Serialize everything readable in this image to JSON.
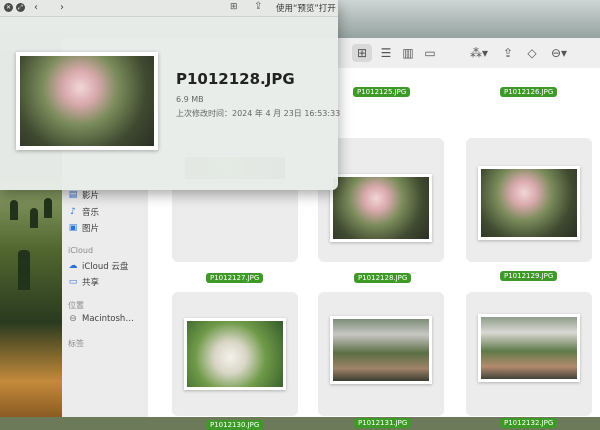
{
  "window": {
    "open_with": "使用“预览”打开"
  },
  "preview": {
    "file_name": "P1012128.JPG",
    "file_size": "6.9 MB",
    "modified": "上次修改时间：2024 年 4 月 23日 16:53:33"
  },
  "sidebar": {
    "items_top": [
      {
        "icon": "music-icon",
        "label": "音乐"
      },
      {
        "icon": "photo-icon",
        "label": "图片"
      }
    ],
    "icloud_header": "iCloud",
    "icloud_items": [
      {
        "icon": "cloud-icon",
        "label": "iCloud 云盘"
      },
      {
        "icon": "shared-folder-icon",
        "label": "共享"
      }
    ],
    "locations_header": "位置",
    "location_items": [
      {
        "icon": "disk-icon",
        "label": "Macintosh…"
      }
    ],
    "tags_header": "标签",
    "partial_label": "影片"
  },
  "files": {
    "row0": [
      "P1012125.JPG",
      "P1012126.JPG"
    ],
    "row1": [
      "P1012127.JPG",
      "P1012128.JPG",
      "P1012129.JPG"
    ],
    "row2": [
      "P1012130.JPG",
      "P1012131.JPG",
      "P1012132.JPG"
    ]
  },
  "colors": {
    "tag_green": "#3e9a27"
  }
}
